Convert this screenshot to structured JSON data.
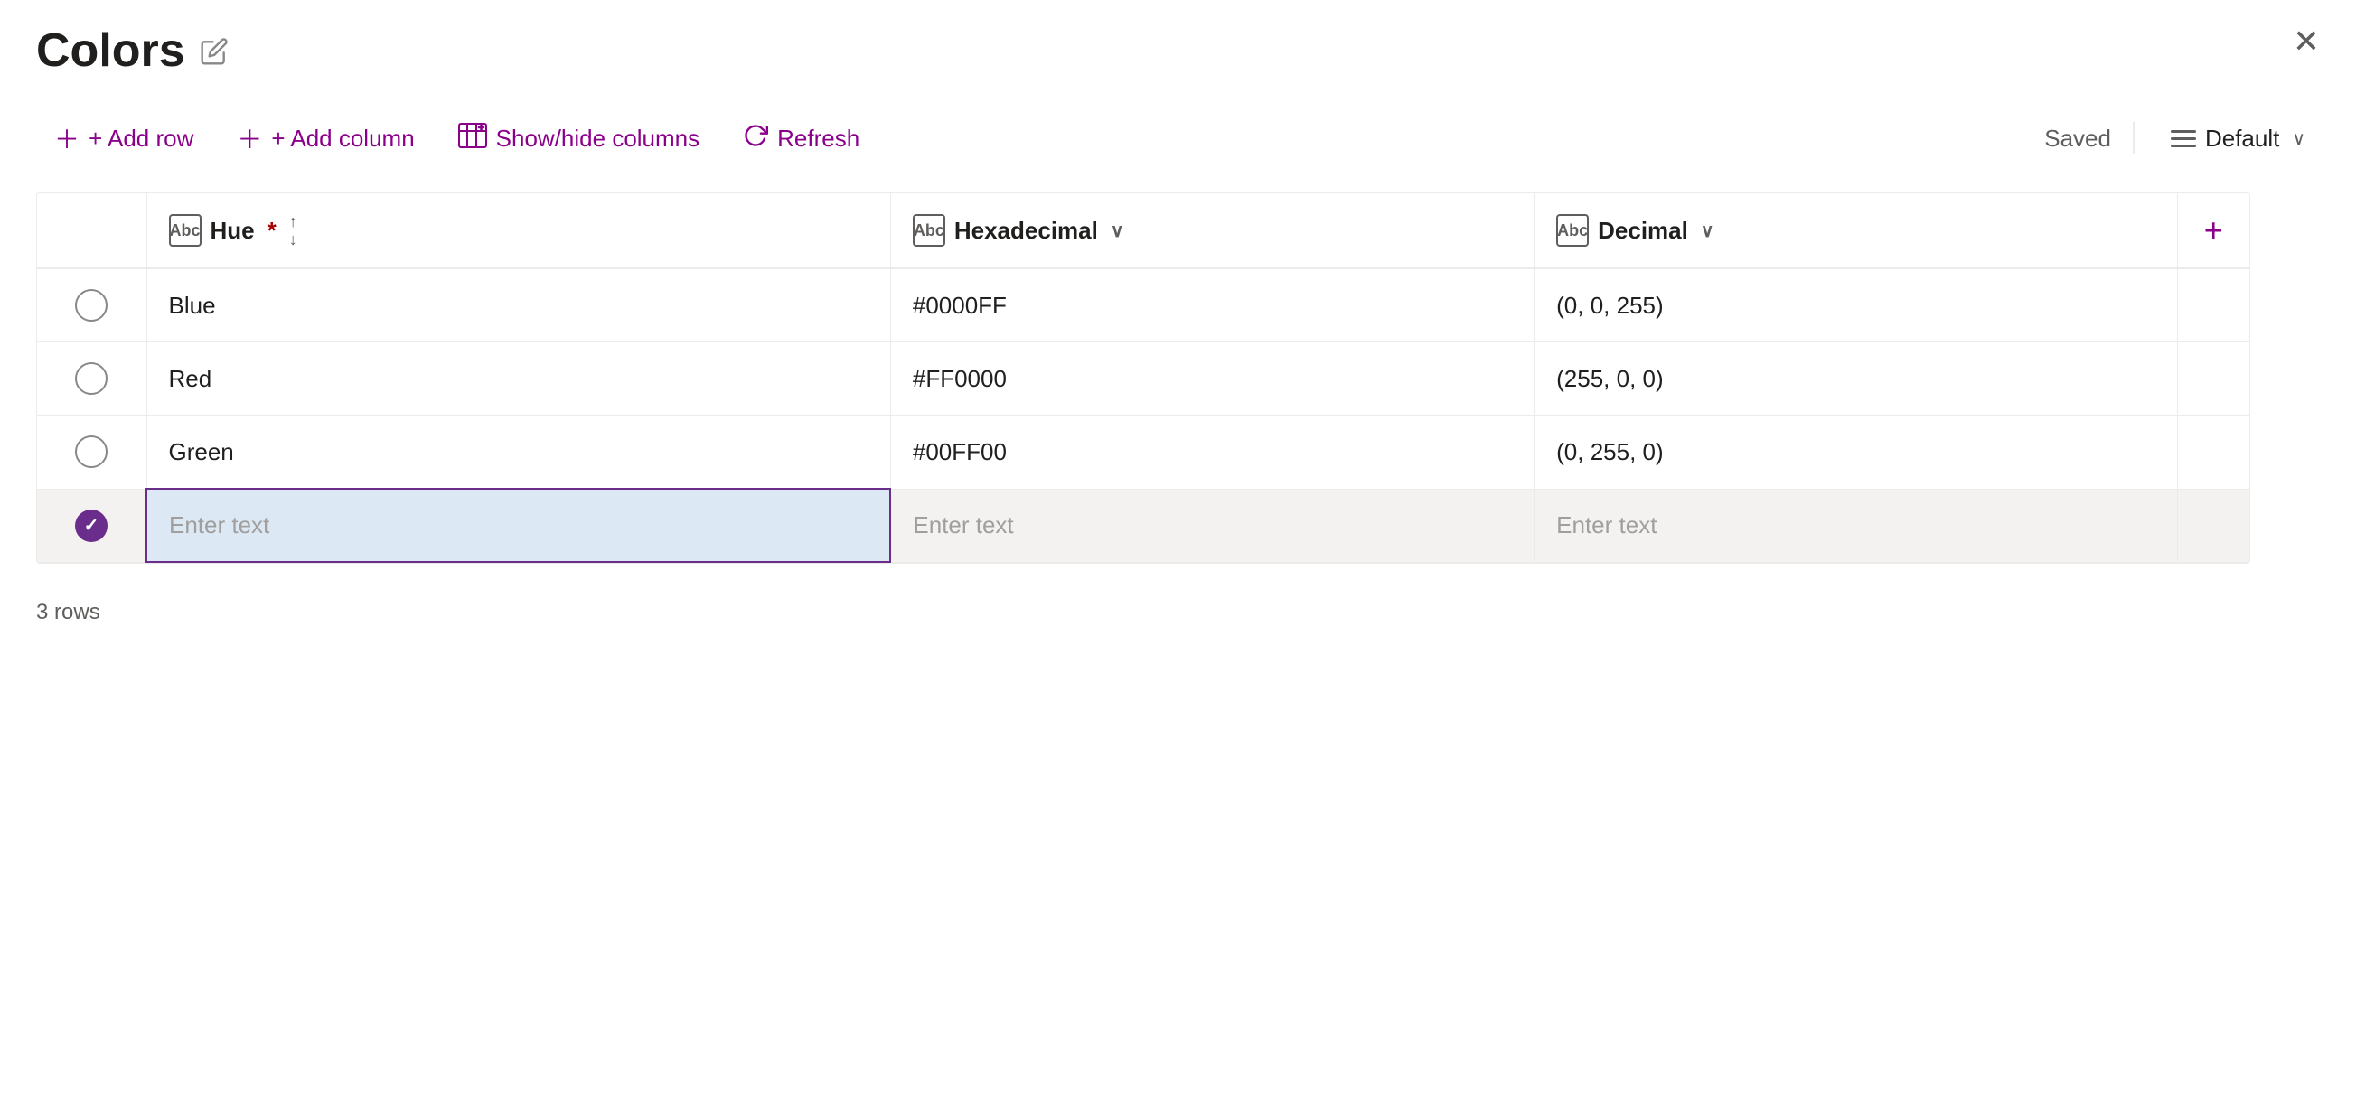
{
  "title": "Colors",
  "toolbar": {
    "add_row": "+ Add row",
    "add_column": "+ Add column",
    "show_hide": "Show/hide columns",
    "refresh": "Refresh",
    "saved": "Saved",
    "default": "Default"
  },
  "columns": [
    {
      "id": "hue",
      "label": "Hue",
      "required": true,
      "sortable": true,
      "filterable": true
    },
    {
      "id": "hexadecimal",
      "label": "Hexadecimal",
      "required": false,
      "sortable": false,
      "filterable": true
    },
    {
      "id": "decimal",
      "label": "Decimal",
      "required": false,
      "sortable": false,
      "filterable": true
    }
  ],
  "rows": [
    {
      "hue": "Blue",
      "hexadecimal": "#0000FF",
      "decimal": "(0, 0, 255)"
    },
    {
      "hue": "Red",
      "hexadecimal": "#FF0000",
      "decimal": "(255, 0, 0)"
    },
    {
      "hue": "Green",
      "hexadecimal": "#00FF00",
      "decimal": "(0, 255, 0)"
    }
  ],
  "new_row_placeholder": "Enter text",
  "footer": "3 rows",
  "accent_color": "#6b2d8b"
}
